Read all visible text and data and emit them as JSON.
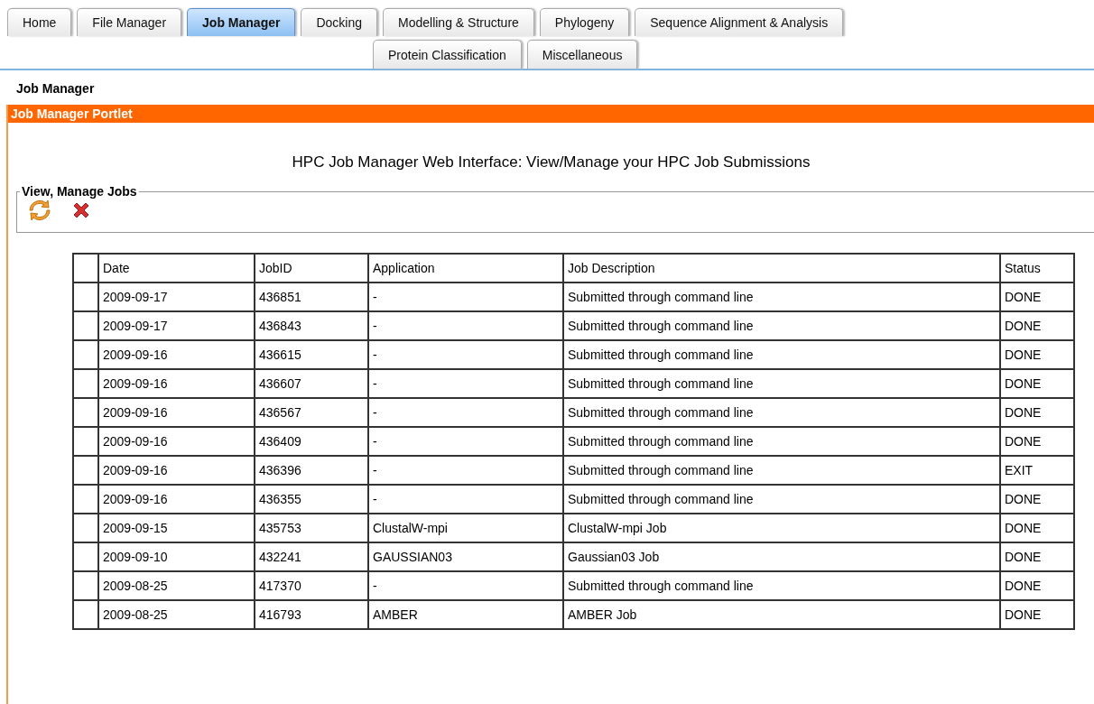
{
  "tab_rows": [
    {
      "tabs": [
        {
          "label": "Home",
          "selected": false
        },
        {
          "label": "File Manager",
          "selected": false
        },
        {
          "label": "Job Manager",
          "selected": true
        },
        {
          "label": "Docking",
          "selected": false
        },
        {
          "label": "Modelling & Structure",
          "selected": false
        },
        {
          "label": "Phylogeny",
          "selected": false
        },
        {
          "label": "Sequence Alignment & Analysis",
          "selected": false
        }
      ]
    },
    {
      "tabs": [
        {
          "label": "Protein Classification",
          "selected": false
        },
        {
          "label": "Miscellaneous",
          "selected": false
        }
      ]
    }
  ],
  "page_title": "Job Manager",
  "portlet": {
    "title": "Job Manager Portlet",
    "heading": "HPC Job Manager Web Interface: View/Manage your HPC Job Submissions",
    "fieldset": {
      "legend": "View, Manage Jobs"
    },
    "table": {
      "columns": [
        "Date",
        "JobID",
        "Application",
        "Job Description",
        "Status"
      ],
      "rows": [
        [
          "2009-09-17",
          "436851",
          "-",
          "Submitted through command line",
          "DONE"
        ],
        [
          "2009-09-17",
          "436843",
          "-",
          "Submitted through command line",
          "DONE"
        ],
        [
          "2009-09-16",
          "436615",
          "-",
          "Submitted through command line",
          "DONE"
        ],
        [
          "2009-09-16",
          "436607",
          "-",
          "Submitted through command line",
          "DONE"
        ],
        [
          "2009-09-16",
          "436567",
          "-",
          "Submitted through command line",
          "DONE"
        ],
        [
          "2009-09-16",
          "436409",
          "-",
          "Submitted through command line",
          "DONE"
        ],
        [
          "2009-09-16",
          "436396",
          "-",
          "Submitted through command line",
          "EXIT"
        ],
        [
          "2009-09-16",
          "436355",
          "-",
          "Submitted through command line",
          "DONE"
        ],
        [
          "2009-09-15",
          "435753",
          "ClustalW-mpi",
          "ClustalW-mpi Job",
          "DONE"
        ],
        [
          "2009-09-10",
          "432241",
          "GAUSSIAN03",
          "Gaussian03 Job",
          "DONE"
        ],
        [
          "2009-08-25",
          "417370",
          "-",
          "Submitted through command line",
          "DONE"
        ],
        [
          "2009-08-25",
          "416793",
          "AMBER",
          "AMBER Job",
          "DONE"
        ]
      ]
    }
  }
}
